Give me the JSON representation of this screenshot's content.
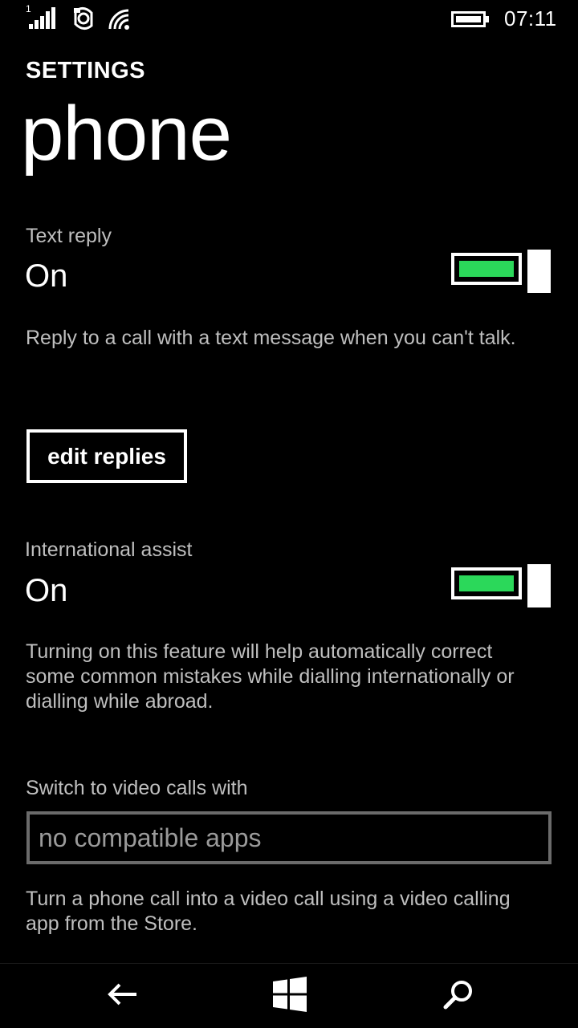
{
  "status_bar": {
    "sim_number": "1",
    "time": "07:11",
    "icons": [
      "signal-icon",
      "data-sync-icon",
      "wifi-icon",
      "battery-icon"
    ]
  },
  "header": {
    "section": "SETTINGS",
    "title": "phone"
  },
  "text_reply": {
    "label": "Text reply",
    "state": "On",
    "enabled": true,
    "description": "Reply to a call with a text message when you can't talk.",
    "edit_button": "edit replies"
  },
  "international_assist": {
    "label": "International assist",
    "state": "On",
    "enabled": true,
    "description": "Turning on this feature will help automatically correct some common mistakes while dialling internationally or dialling while abroad."
  },
  "video_calls": {
    "label": "Switch to video calls with",
    "selected": "no compatible apps",
    "description": "Turn a phone call into a video call using a video calling app from the Store."
  },
  "nav_bar": {
    "icons": [
      "back-arrow-icon",
      "windows-start-icon",
      "search-icon"
    ]
  },
  "colors": {
    "background": "#000000",
    "toggle_on": "#2bd85a",
    "text_secondary": "#bfbfbf"
  }
}
